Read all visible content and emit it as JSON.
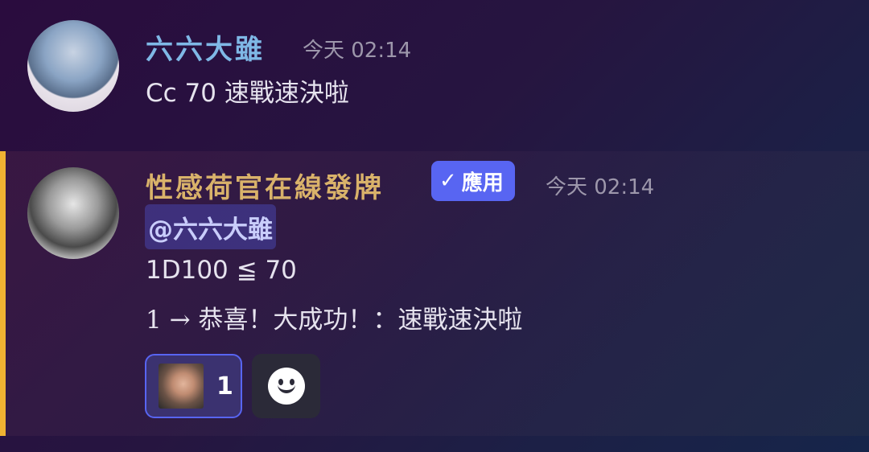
{
  "messages": [
    {
      "author": "六六大雖",
      "timestamp": "今天 02:14",
      "avatar": "avatar-anime-character",
      "content": "Cc 70 速戰速決啦"
    },
    {
      "author": "性感荷官在線發牌",
      "app_badge": "應用",
      "timestamp": "今天 02:14",
      "avatar": "avatar-cthulhu",
      "mention": "@六六大雖",
      "roll_line": "1D100 ≦ 70",
      "result_line": "1 → 恭喜！大成功！：速戰速決啦",
      "reactions": [
        {
          "emoji": "custom-face-emoji",
          "count": "1",
          "active": true
        }
      ]
    }
  ],
  "colors": {
    "highlight_bar": "#f0b232",
    "author_1": "#7fb8e6",
    "author_2": "#d9b26a",
    "app_badge": "#5865f2",
    "mention_text": "#c9cdfb"
  }
}
